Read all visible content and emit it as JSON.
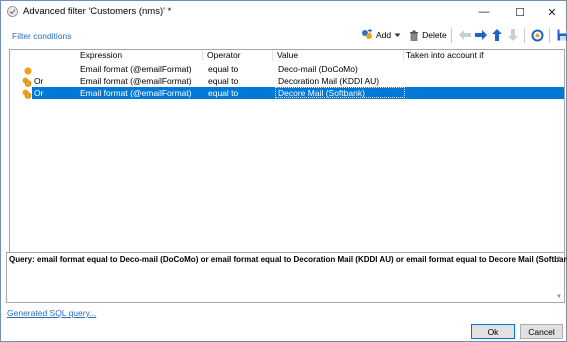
{
  "window": {
    "title": "Advanced filter 'Customers (nms)' *",
    "minimize_glyph": "—",
    "maximize_glyph": "☐",
    "close_glyph": "✕"
  },
  "filter_conditions_label": "Filter conditions",
  "toolbar": {
    "add_label": "Add",
    "delete_label": "Delete",
    "icons": [
      "add-icon",
      "dropdown-arrow-icon",
      "delete-icon",
      "arrow-left-icon",
      "arrow-right-icon",
      "arrow-up-icon",
      "arrow-down-icon",
      "refresh-icon",
      "save-icon"
    ]
  },
  "grid": {
    "columns": [
      "Expression",
      "Operator",
      "Value",
      "Taken into account if"
    ],
    "rows": [
      {
        "operator_prefix": "",
        "expression": "Email format (@emailFormat)",
        "operator": "equal to",
        "value": "Deco-mail (DoCoMo)",
        "taken": "",
        "selected": false
      },
      {
        "operator_prefix": "Or",
        "expression": "Email format (@emailFormat)",
        "operator": "equal to",
        "value": "Decoration Mail (KDDI AU)",
        "taken": "",
        "selected": false
      },
      {
        "operator_prefix": "Or",
        "expression": "Email format (@emailFormat)",
        "operator": "equal to",
        "value": "Decore Mail (Softbank)",
        "taken": "",
        "selected": true
      }
    ]
  },
  "query_text": "Query: email format equal to Deco-mail (DoCoMo) or email format equal to Decoration Mail (KDDI AU) or email format equal to Decore Mail (Softbank)",
  "generated_sql_link": "Generated SQL query...",
  "buttons": {
    "ok": "Ok",
    "cancel": "Cancel"
  },
  "colors": {
    "accent": "#0078d7",
    "link": "#2a6ebd",
    "condition_dot": "#f0a020"
  }
}
